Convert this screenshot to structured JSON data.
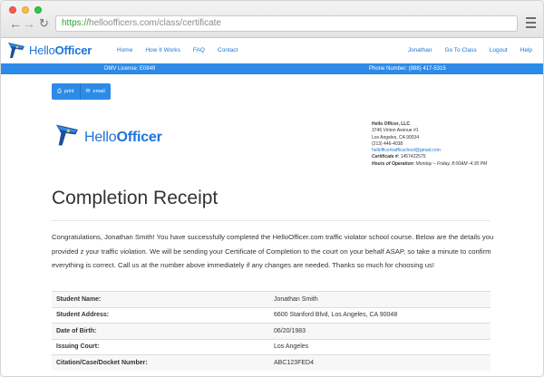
{
  "browser": {
    "url_scheme": "https://",
    "url_rest": "helloofficers.com/class/certificate"
  },
  "brand": {
    "name_light": "Hello",
    "name_bold": "Officer",
    "color": "#1d74d8"
  },
  "nav": {
    "left": [
      "Home",
      "How It Works",
      "FAQ",
      "Contact"
    ],
    "right": [
      "Jonathan",
      "Go To Class",
      "Logout",
      "Help"
    ]
  },
  "info_bar": {
    "license": "DMV License: E0849",
    "phone": "Phone Number: (888) 417-5315",
    "color": "#2d8be8"
  },
  "actions": {
    "print_label": "print",
    "email_label": "email"
  },
  "address": {
    "company": "Hello Officer, LLC",
    "street": "3746 Vinton Avenue #1",
    "city": "Los Angeles, CA 90034",
    "phone": "(213) 446-4038",
    "email": "hellofficertrafficschool@gmail.com",
    "certificate_label": "Certificate #:",
    "certificate_value": "1457422575",
    "hours_label": "Hours of Operation:",
    "hours_value": "Monday – Friday, 8:00AM -4:30 PM"
  },
  "receipt": {
    "title": "Completion Receipt",
    "intro": "Congratulations, Jonathan Smith! You have successfully completed the HelloOfficer.com traffic violator school course. Below are the details you provided z your traffic violation. We will be sending your Certificate of Completion to the court on your behalf ASAP, so take a minute to confirm everything is correct. Call us at the number above immediately if any changes are needed. Thanks so much for choosing us!",
    "rows": [
      {
        "label": "Student Name:",
        "value": "Jonathan Smith"
      },
      {
        "label": "Student Address:",
        "value": "6600 Stanford Blvd, Los Angeles, CA 90048"
      },
      {
        "label": "Date of Birth:",
        "value": "06/20/1983"
      },
      {
        "label": "Issuing Court:",
        "value": "Los Angeles"
      },
      {
        "label": "Citation/Case/Docket Number:",
        "value": "ABC123FED4"
      }
    ]
  }
}
